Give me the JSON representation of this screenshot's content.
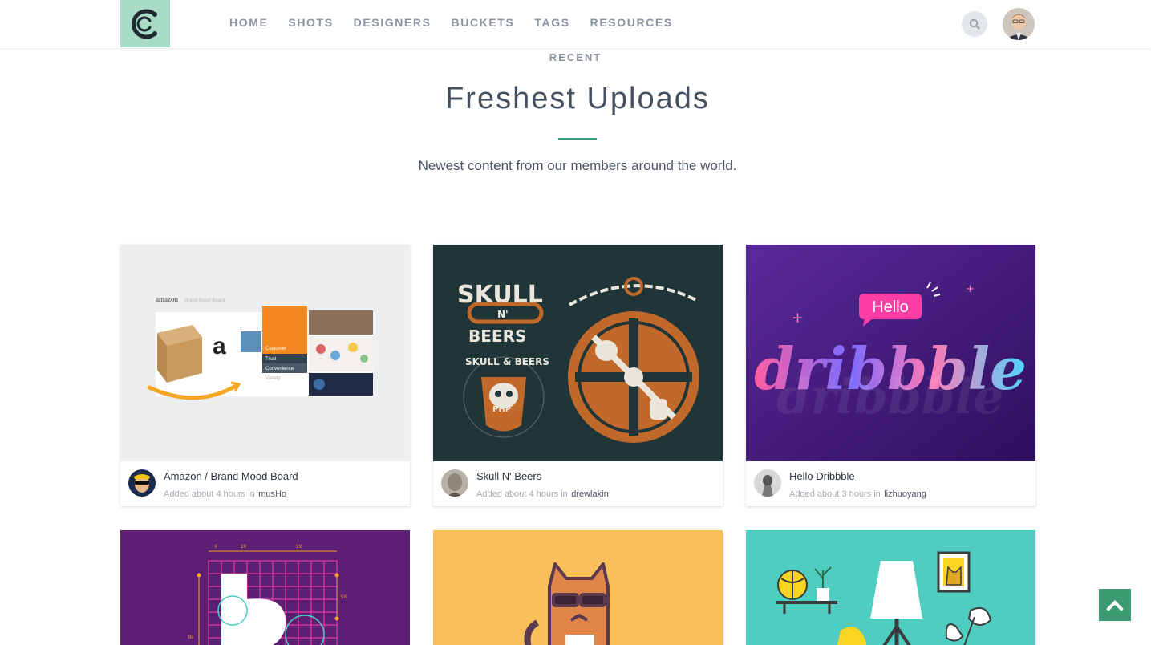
{
  "nav": {
    "items": [
      "HOME",
      "SHOTS",
      "DESIGNERS",
      "BUCKETS",
      "TAGS",
      "RESOURCES"
    ]
  },
  "hero": {
    "eyebrow": "RECENT",
    "title": "Freshest Uploads",
    "subtitle": "Newest content from our members around the world."
  },
  "cards": [
    {
      "title": "Amazon / Brand Mood Board",
      "added": "Added about 4 hours in",
      "user": "musHo"
    },
    {
      "title": "Skull N' Beers",
      "added": "Added about 4 hours in",
      "user": "drewlakin"
    },
    {
      "title": "Hello Dribbble",
      "added": "Added about 3 hours in",
      "user": "lizhuoyang"
    }
  ],
  "artwork": {
    "amazon_brand": "amazon",
    "amazon_caption": "Brand Mood Board",
    "amazon_letter": "a",
    "amazon_words": [
      "Customer",
      "Trust",
      "Convenience",
      "Variety"
    ],
    "skull_words": [
      "SKULL",
      "N'",
      "BEERS",
      "SKULL & BEERS",
      "PHP"
    ],
    "hello_bubble": "Hello",
    "hello_script": "dribbble",
    "grid_marks": [
      "X",
      "2X",
      "3X",
      "5X",
      "9x"
    ]
  },
  "colors": {
    "accent": "#3c9b72",
    "logo_bg": "#a9dcc7",
    "purple": "#5c1f73",
    "orange": "#f9bf5b",
    "teal": "#4ecdc0"
  },
  "icons": [
    "logo-icon",
    "search-icon",
    "chevron-up-icon"
  ]
}
